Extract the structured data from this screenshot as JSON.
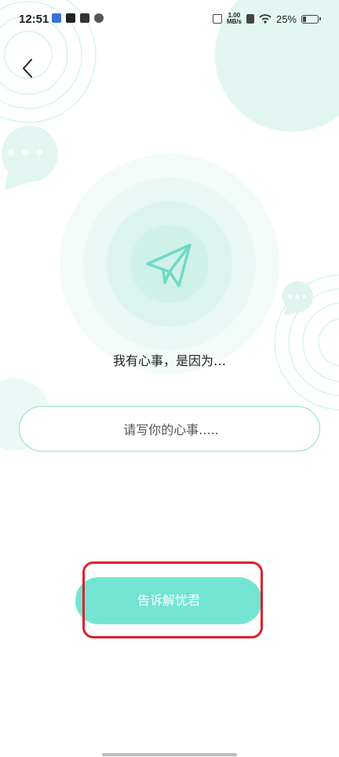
{
  "status_bar": {
    "time": "12:51",
    "net_speed_value": "1.00",
    "net_speed_unit": "MB/s",
    "battery_percent": "25%",
    "battery_level": 0.25
  },
  "main": {
    "prompt": "我有心事，是因为…",
    "input_placeholder": "请写你的心事.....",
    "submit_label": "告诉解忧君"
  },
  "colors": {
    "accent": "#74e4d2",
    "outline": "#8fe0cf",
    "highlight": "#d9232d"
  }
}
